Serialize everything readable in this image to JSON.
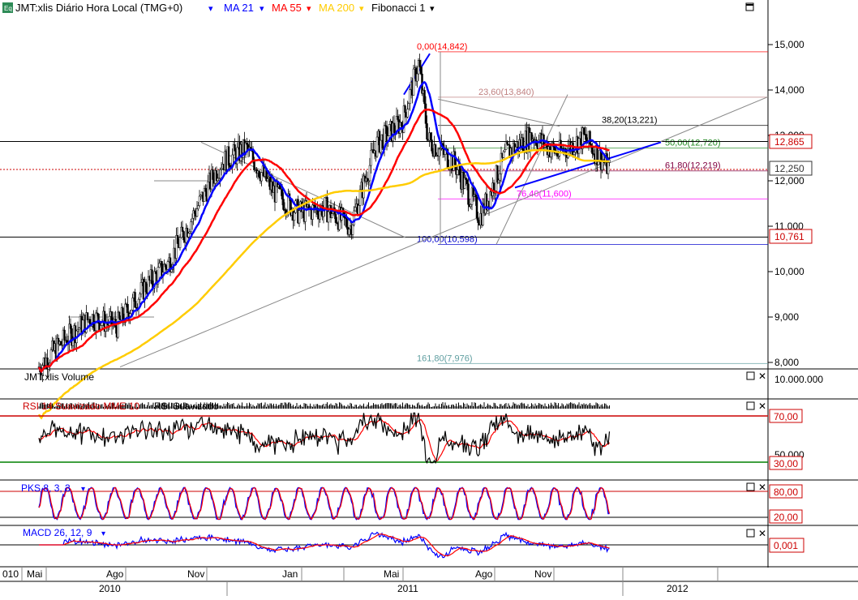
{
  "header": {
    "icon_text": "Eq",
    "instrument": "JMT:xlis Diário Hora Local (TMG+0)",
    "indicators": [
      {
        "label": "MA 21",
        "color": "#0000ff"
      },
      {
        "label": "MA 55",
        "color": "#ff0000"
      },
      {
        "label": "MA 200",
        "color": "#ffcc00"
      },
      {
        "label": "Fibonacci 1",
        "color": "#000000"
      }
    ]
  },
  "panels": {
    "volume": {
      "title": "JMT:xlis Volume",
      "axis_label": "10.000.000"
    },
    "rsi": {
      "title": "RSI 14 Suavizado MME 10",
      "title2": "RSI Suavizado",
      "ticks": [
        "70,00",
        "50,000",
        "30,00"
      ]
    },
    "stoch": {
      "title": "PKS 8, 3, 3",
      "ticks": [
        "80,00",
        "20,00"
      ]
    },
    "macd": {
      "title": "MACD 26, 12, 9",
      "ticks": [
        "0,001"
      ]
    }
  },
  "price_badges": [
    {
      "text": "12,865",
      "color": "#cc0000"
    },
    {
      "text": "12,250",
      "color": "#333333"
    },
    {
      "text": "10,761",
      "color": "#cc0000"
    }
  ],
  "fib_labels": [
    {
      "text": "0,00(14,842)",
      "color": "#ff0000",
      "value": 14.842
    },
    {
      "text": "23,60(13,840)",
      "color": "#c08080",
      "value": 13.84
    },
    {
      "text": "38,20(13,221)",
      "color": "#000000",
      "value": 13.221
    },
    {
      "text": "50,00(12,720)",
      "color": "#228b22",
      "value": 12.72
    },
    {
      "text": "61,80(12,219)",
      "color": "#800040",
      "value": 12.219
    },
    {
      "text": "76,40(11,600)",
      "color": "#ff00ff",
      "value": 11.6
    },
    {
      "text": "100,00(10,598)",
      "color": "#0000cc",
      "value": 10.598
    },
    {
      "text": "161,80(7,976)",
      "color": "#5f9ea0",
      "value": 7.976
    }
  ],
  "time_axis": {
    "months": [
      "010",
      "Mai",
      "Ago",
      "Nov",
      "Jan",
      "Mai",
      "Ago",
      "Nov"
    ],
    "years": [
      "2010",
      "2011",
      "2012"
    ]
  },
  "colors": {
    "ma21": "#0000ff",
    "ma55": "#ff0000",
    "ma200": "#ffcc00",
    "rsi": "#000000",
    "signal": "#ff0000",
    "macd": "#0000ff"
  },
  "chart_data": {
    "type": "candlestick",
    "title": "JMT:xlis Diário Hora Local (TMG+0)",
    "y_ticks": [
      "8,000",
      "9,000",
      "10,000",
      "11,000",
      "12,000",
      "13,000",
      "14,000",
      "15,000"
    ],
    "ylim": [
      7.8,
      15.9
    ],
    "last_price": 12.25,
    "close_path": [
      [
        "2010-03",
        7.9
      ],
      [
        "2010-04",
        8.5
      ],
      [
        "2010-05",
        9.0
      ],
      [
        "2010-06",
        8.8
      ],
      [
        "2010-07",
        9.6
      ],
      [
        "2010-08",
        10.2
      ],
      [
        "2010-09",
        11.3
      ],
      [
        "2010-10",
        12.4
      ],
      [
        "2010-11",
        12.7
      ],
      [
        "2010-12",
        11.8
      ],
      [
        "2011-01",
        11.3
      ],
      [
        "2011-02",
        11.4
      ],
      [
        "2011-03",
        11.0
      ],
      [
        "2011-04",
        12.8
      ],
      [
        "2011-05",
        13.3
      ],
      [
        "2011-05-20",
        14.6
      ],
      [
        "2011-06",
        12.9
      ],
      [
        "2011-07",
        12.4
      ],
      [
        "2011-08",
        11.2
      ],
      [
        "2011-09",
        12.6
      ],
      [
        "2011-10",
        13.0
      ],
      [
        "2011-11",
        12.6
      ],
      [
        "2011-12",
        12.95
      ],
      [
        "2012-01",
        12.25
      ]
    ],
    "fibonacci": {
      "high": 14.842,
      "low": 10.598,
      "levels": [
        0,
        23.6,
        38.2,
        50,
        61.8,
        76.4,
        100,
        161.8
      ]
    },
    "rsi": {
      "levels": [
        70,
        50,
        30
      ],
      "last": 40
    },
    "stochastic": {
      "levels": [
        80,
        20
      ],
      "last": 18
    }
  }
}
